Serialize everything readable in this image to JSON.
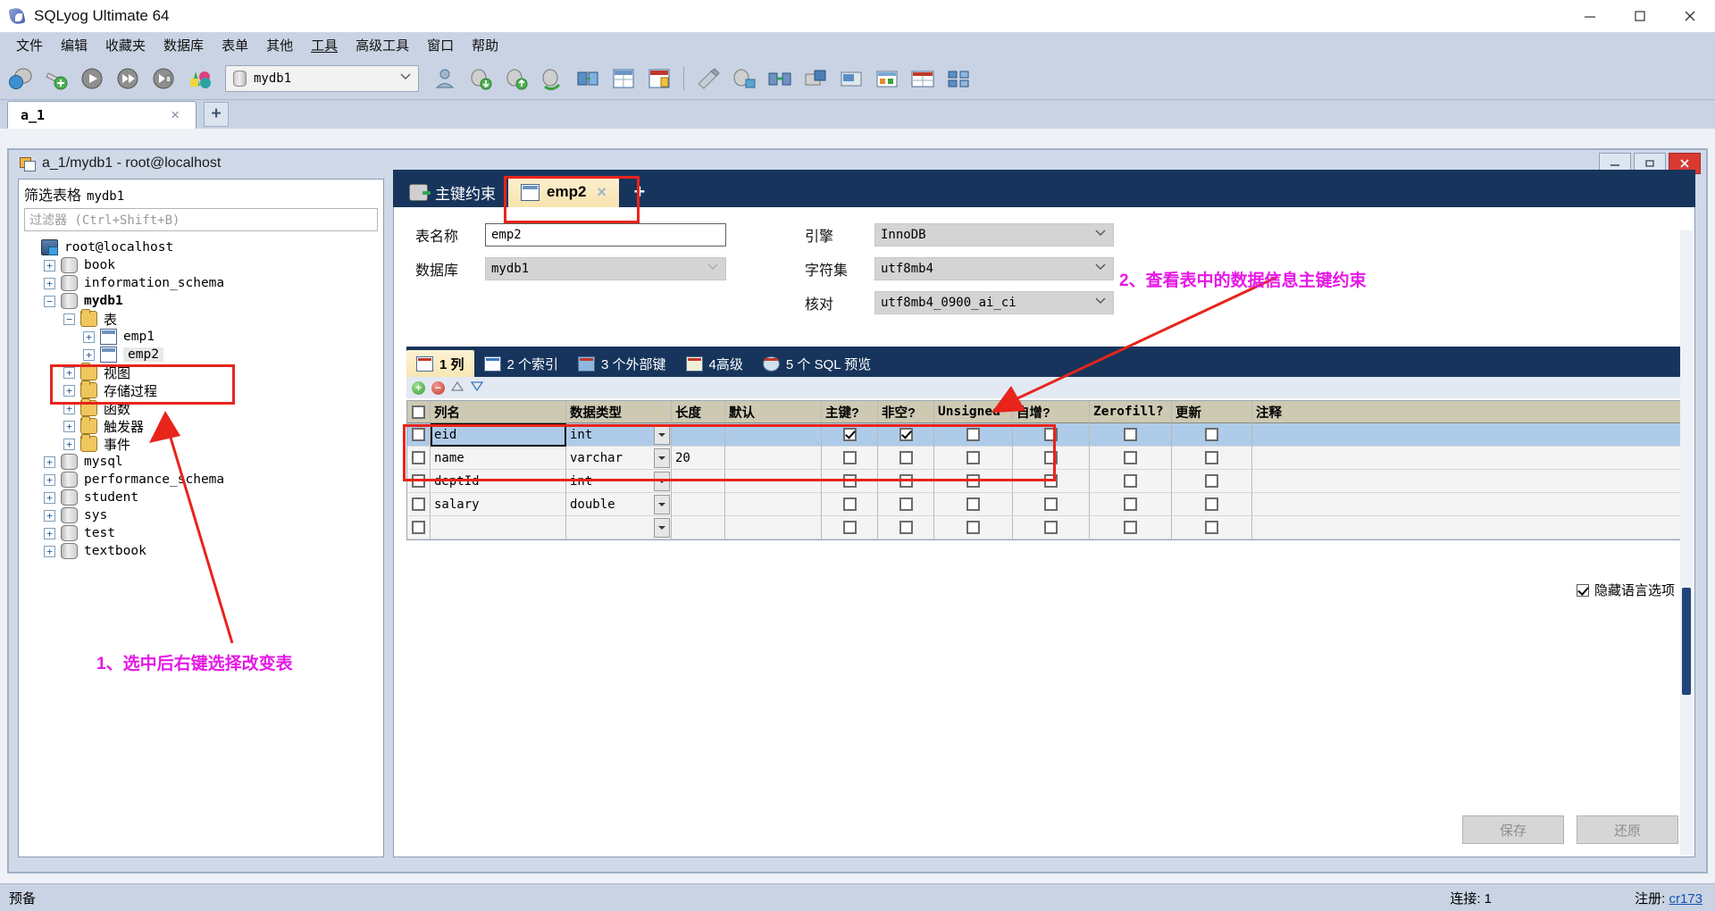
{
  "window": {
    "title": "SQLyog Ultimate 64",
    "icon": "sqlyog-dolphin-icon",
    "minimize": "minimize-icon",
    "maximize": "maximize-icon",
    "close": "close-icon"
  },
  "menubar": {
    "items": [
      "文件",
      "编辑",
      "收藏夹",
      "数据库",
      "表单",
      "其他",
      "工具",
      "高级工具",
      "窗口",
      "帮助"
    ]
  },
  "toolbar": {
    "db_selector_value": "mydb1",
    "buttons": [
      "new-connection-icon",
      "add-connection-icon",
      "execute-query-icon",
      "execute-all-icon",
      "execute-current-icon",
      "refresh-objects-icon"
    ],
    "buttons2": [
      "user-manager-icon",
      "import-data-icon",
      "export-data-icon",
      "restore-icon",
      "sync-icon",
      "table-data-icon",
      "schema-designer-icon"
    ],
    "buttons3": [
      "sql-formatter-icon",
      "backup-icon",
      "compare-icon",
      "migrate-icon",
      "notifications-icon",
      "report-icon",
      "query-builder-icon",
      "object-browser-icon"
    ]
  },
  "app_tabs": {
    "tabs": [
      {
        "label": "a_1",
        "close": "×"
      }
    ],
    "add_label": "+"
  },
  "mdi": {
    "title": "a_1/mydb1 - root@localhost",
    "icon": "mdi-window-icon",
    "minimize": "—",
    "restore": "❐",
    "close": "✕"
  },
  "browser": {
    "header_label": "筛选表格",
    "header_db": "mydb1",
    "filter_placeholder": "过滤器 (Ctrl+Shift+B)",
    "tree": [
      {
        "label": "root@localhost",
        "icon": "server-icon",
        "expander": "",
        "indent": 0,
        "bold": false,
        "cjk": false
      },
      {
        "label": "book",
        "icon": "database-icon",
        "expander": "+",
        "indent": 1,
        "bold": false,
        "cjk": false
      },
      {
        "label": "information_schema",
        "icon": "database-icon",
        "expander": "+",
        "indent": 1,
        "bold": false,
        "cjk": false
      },
      {
        "label": "mydb1",
        "icon": "database-icon",
        "expander": "−",
        "indent": 1,
        "bold": true,
        "cjk": false
      },
      {
        "label": "表",
        "icon": "folder-icon",
        "expander": "−",
        "indent": 2,
        "bold": false,
        "cjk": true
      },
      {
        "label": "emp1",
        "icon": "table-icon",
        "expander": "+",
        "indent": 3,
        "bold": false,
        "cjk": false
      },
      {
        "label": "emp2",
        "icon": "table-icon",
        "expander": "+",
        "indent": 3,
        "bold": false,
        "cjk": false,
        "selected": true
      },
      {
        "label": "视图",
        "icon": "folder-icon",
        "expander": "+",
        "indent": 2,
        "bold": false,
        "cjk": true
      },
      {
        "label": "存储过程",
        "icon": "folder-icon",
        "expander": "+",
        "indent": 2,
        "bold": false,
        "cjk": true
      },
      {
        "label": "函数",
        "icon": "folder-icon",
        "expander": "+",
        "indent": 2,
        "bold": false,
        "cjk": true
      },
      {
        "label": "触发器",
        "icon": "folder-icon",
        "expander": "+",
        "indent": 2,
        "bold": false,
        "cjk": true
      },
      {
        "label": "事件",
        "icon": "folder-icon",
        "expander": "+",
        "indent": 2,
        "bold": false,
        "cjk": true
      },
      {
        "label": "mysql",
        "icon": "database-icon",
        "expander": "+",
        "indent": 1,
        "bold": false,
        "cjk": false
      },
      {
        "label": "performance_schema",
        "icon": "database-icon",
        "expander": "+",
        "indent": 1,
        "bold": false,
        "cjk": false
      },
      {
        "label": "student",
        "icon": "database-icon",
        "expander": "+",
        "indent": 1,
        "bold": false,
        "cjk": false
      },
      {
        "label": "sys",
        "icon": "database-icon",
        "expander": "+",
        "indent": 1,
        "bold": false,
        "cjk": false
      },
      {
        "label": "test",
        "icon": "database-icon",
        "expander": "+",
        "indent": 1,
        "bold": false,
        "cjk": false
      },
      {
        "label": "textbook",
        "icon": "database-icon",
        "expander": "+",
        "indent": 1,
        "bold": false,
        "cjk": false
      }
    ]
  },
  "editor": {
    "tabs": [
      {
        "label": "主键约束",
        "icon": "key-constraint-icon",
        "active": false,
        "closable": false
      },
      {
        "label": "emp2",
        "icon": "table-icon",
        "active": true,
        "closable": true,
        "close": "×"
      }
    ],
    "add_tab": "+",
    "form": {
      "table_name_label": "表名称",
      "table_name_value": "emp2",
      "database_label": "数据库",
      "database_value": "mydb1",
      "engine_label": "引擎",
      "engine_value": "InnoDB",
      "charset_label": "字符集",
      "charset_value": "utf8mb4",
      "collation_label": "核对",
      "collation_value": "utf8mb4_0900_ai_ci"
    },
    "hide_language_option": "隐藏语言选项",
    "inner_tabs": [
      {
        "label": "1 列",
        "active": true
      },
      {
        "label": "2 个索引",
        "active": false
      },
      {
        "label": "3 个外部键",
        "active": false
      },
      {
        "label": "4高级",
        "active": false
      },
      {
        "label": "5 个 SQL 预览",
        "active": false
      }
    ],
    "grid": {
      "columns": [
        "",
        "列名",
        "数据类型",
        "长度",
        "默认",
        "主键?",
        "非空?",
        "Unsigned",
        "自增?",
        "Zerofill?",
        "更新",
        "注释"
      ],
      "rows": [
        {
          "name": "eid",
          "type": "int",
          "length": "",
          "default": "",
          "pk": true,
          "notnull": true,
          "unsigned": false,
          "autoinc": false,
          "zerofill": false,
          "update": false,
          "comment": "",
          "selected": true
        },
        {
          "name": "name",
          "type": "varchar",
          "length": "20",
          "default": "",
          "pk": false,
          "notnull": false,
          "unsigned": false,
          "autoinc": false,
          "zerofill": false,
          "update": false,
          "comment": "",
          "selected": false
        },
        {
          "name": "deptId",
          "type": "int",
          "length": "",
          "default": "",
          "pk": false,
          "notnull": false,
          "unsigned": false,
          "autoinc": false,
          "zerofill": false,
          "update": false,
          "comment": "",
          "selected": false
        },
        {
          "name": "salary",
          "type": "double",
          "length": "",
          "default": "",
          "pk": false,
          "notnull": false,
          "unsigned": false,
          "autoinc": false,
          "zerofill": false,
          "update": false,
          "comment": "",
          "selected": false
        },
        {
          "name": "",
          "type": "",
          "length": "",
          "default": "",
          "pk": false,
          "notnull": false,
          "unsigned": false,
          "autoinc": false,
          "zerofill": false,
          "update": false,
          "comment": "",
          "selected": false
        }
      ]
    },
    "save_button": "保存",
    "revert_button": "还原"
  },
  "statusbar": {
    "left": "预备",
    "connection": "连接: 1",
    "register_label": "注册:",
    "register_user": "cr173"
  },
  "annotations": [
    {
      "id": "ann-1",
      "text": "1、选中后右键选择改变表",
      "color": "#e617e6"
    },
    {
      "id": "ann-2",
      "text": "2、查看表中的数据信息主键约束",
      "color": "#e617e6"
    }
  ],
  "colors": {
    "accent_dark_blue": "#17355c",
    "active_tab": "#f8e6b4",
    "annotation": "#e617e6",
    "highlight_box": "#e8241b",
    "row_selected": "#aecbe9",
    "grid_header": "#cdc9b3"
  }
}
